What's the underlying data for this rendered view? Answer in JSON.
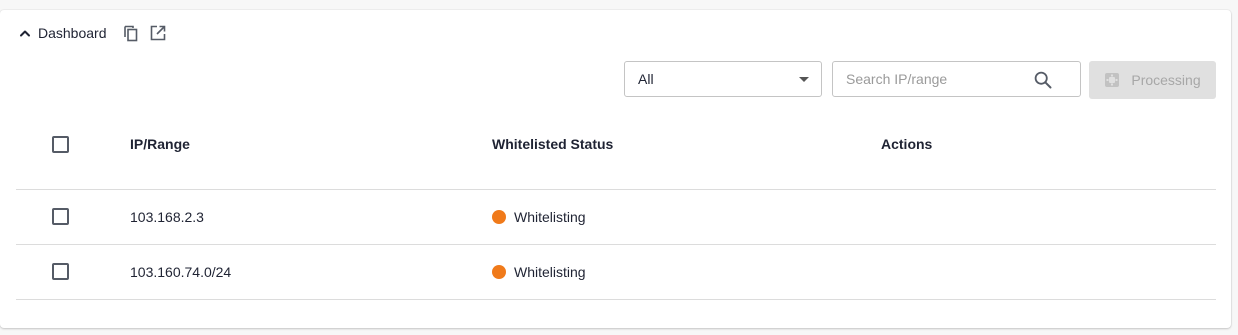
{
  "header": {
    "title": "Dashboard",
    "icons": [
      "chevron-up-icon",
      "copy-icon",
      "open-external-icon"
    ]
  },
  "toolbar": {
    "filter_value": "All",
    "search_placeholder": "Search IP/range",
    "processing_label": "Processing"
  },
  "table": {
    "columns": [
      "IP/Range",
      "Whitelisted Status",
      "Actions"
    ],
    "rows": [
      {
        "ip": "103.168.2.3",
        "status": "Whitelisting",
        "status_color": "#f07a1a"
      },
      {
        "ip": "103.160.74.0/24",
        "status": "Whitelisting",
        "status_color": "#f07a1a"
      }
    ]
  },
  "colors": {
    "status_whitelisting": "#f07a1a",
    "disabled_bg": "#e0e0e0",
    "text": "#1f2333"
  }
}
